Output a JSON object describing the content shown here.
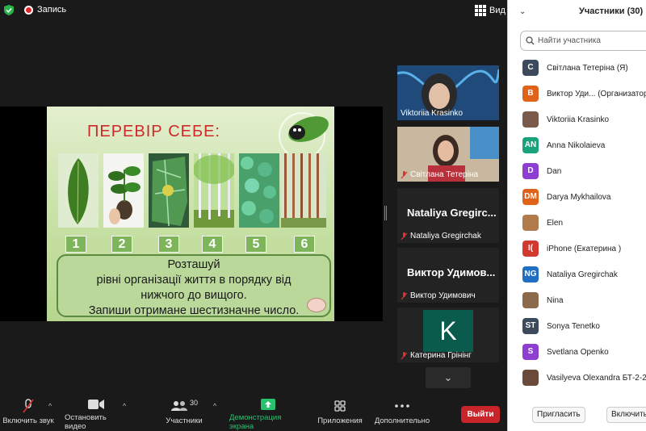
{
  "topbar": {
    "record_label": "Запись",
    "view_label": "Вид"
  },
  "slide": {
    "title": "ПЕРЕВІР СЕБЕ:",
    "numbers": [
      "1",
      "2",
      "3",
      "4",
      "5",
      "6"
    ],
    "task_lines": [
      "Розташуй",
      "рівні організації життя в порядку від",
      "нижчого до вищого.",
      "Запиши отримане  шестизначне число."
    ]
  },
  "thumbnails": [
    {
      "name": "Viktoriia Krasinko",
      "muted": false
    },
    {
      "name": "Світлана Тетеріна",
      "muted": true
    },
    {
      "big": "Nataliya Gregirc...",
      "name": "Nataliya Gregirchak",
      "muted": true
    },
    {
      "big": "Виктор Удимов...",
      "name": "Виктор Удимович",
      "muted": true
    },
    {
      "letter": "K",
      "name": "Катерина Грінінг",
      "muted": true
    }
  ],
  "toolbar": {
    "mute_label": "Включить звук",
    "video_label": "Остановить видео",
    "participants_label": "Участники",
    "participants_count": "30",
    "share_label": "Демонстрация экрана",
    "apps_label": "Приложения",
    "more_label": "Дополнительно",
    "leave_label": "Выйти"
  },
  "panel": {
    "title": "Участники (30)",
    "search_placeholder": "Найти участника",
    "invite_label": "Пригласить",
    "unmute_label": "Включить",
    "participants": [
      {
        "initials": "С",
        "name": "Світлана Тетеріна (Я)",
        "color": "#3d4a5c"
      },
      {
        "initials": "В",
        "name": "Виктор Уди...  (Организатор",
        "color": "#e0631b"
      },
      {
        "initials": "",
        "name": "Viktoriia Krasinko",
        "color": "#7a5a4a"
      },
      {
        "initials": "AN",
        "name": "Anna Nikolaieva",
        "color": "#1aa37a"
      },
      {
        "initials": "D",
        "name": "Dan",
        "color": "#8e3fd1"
      },
      {
        "initials": "DM",
        "name": "Darya Mykhailova",
        "color": "#e0631b"
      },
      {
        "initials": "",
        "name": "Elen",
        "color": "#b07a4a"
      },
      {
        "initials": "I(",
        "name": "iPhone (Екатерина )",
        "color": "#d23a30"
      },
      {
        "initials": "NG",
        "name": "Nataliya Gregirchak",
        "color": "#1f6fc4"
      },
      {
        "initials": "",
        "name": "Nina",
        "color": "#8a6a4a"
      },
      {
        "initials": "ST",
        "name": "Sonya Tenetko",
        "color": "#3d4a5c"
      },
      {
        "initials": "S",
        "name": "Svetlana Openko",
        "color": "#8e3fd1"
      },
      {
        "initials": "",
        "name": "Vasilyeva Olexandra БТ-2-2",
        "color": "#6a4a3a"
      }
    ]
  }
}
